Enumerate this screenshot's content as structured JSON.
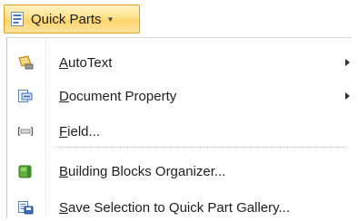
{
  "quick_parts_button": {
    "label": "Quick Parts",
    "icon": "quick-parts-icon",
    "dropdown_icon": "chevron-down-icon"
  },
  "menu": {
    "items": [
      {
        "label": "AutoText",
        "underline": "A",
        "rest": "utoText",
        "icon": "autotext-icon",
        "has_submenu": true
      },
      {
        "label": "Document Property",
        "underline": "D",
        "rest": "ocument Property",
        "icon": "document-property-icon",
        "has_submenu": true
      },
      {
        "label": "Field...",
        "underline": "F",
        "rest": "ield...",
        "icon": "field-icon",
        "has_submenu": false
      },
      {
        "label": "Building Blocks Organizer...",
        "underline": "B",
        "rest": "uilding Blocks Organizer...",
        "icon": "building-blocks-icon",
        "has_submenu": false
      },
      {
        "label": "Save Selection to Quick Part Gallery...",
        "underline": "S",
        "rest": "ave Selection to Quick Part Gallery...",
        "icon": "save-selection-icon",
        "has_submenu": false
      }
    ]
  }
}
